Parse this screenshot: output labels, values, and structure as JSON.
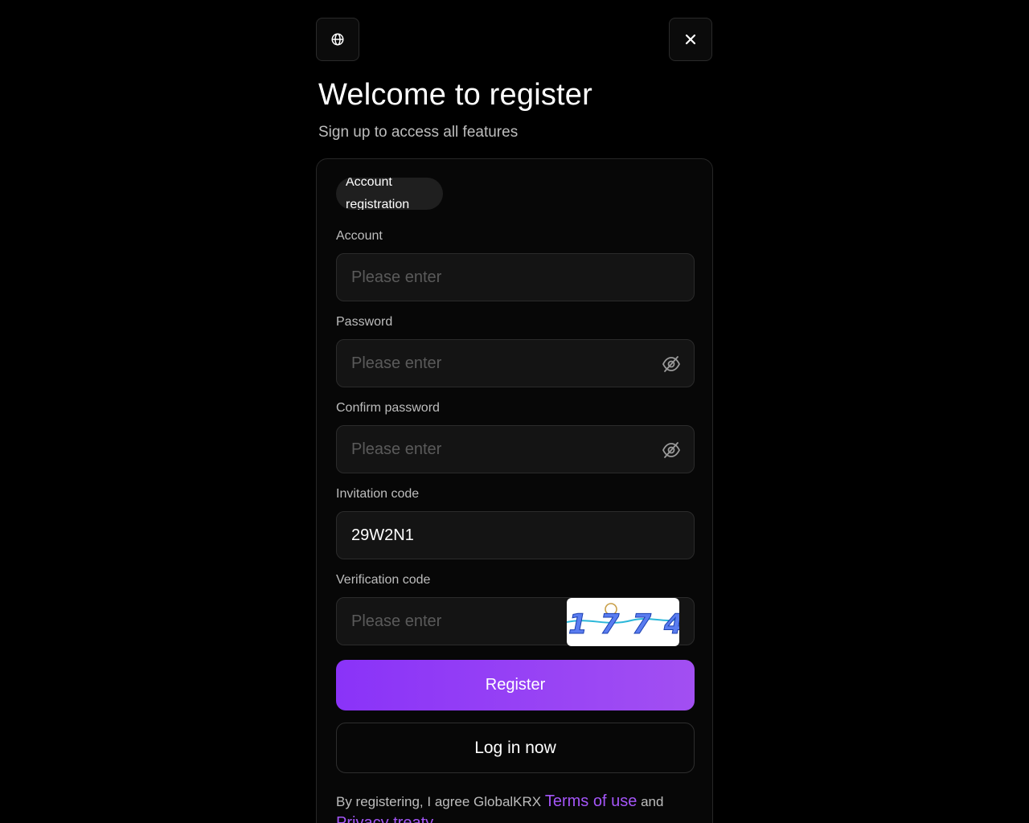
{
  "header": {
    "language_icon": "globe-icon",
    "close_icon": "close-icon",
    "title": "Welcome to register",
    "subtitle": "Sign up to access all features"
  },
  "tabs": [
    {
      "label": "Account registration",
      "active": true
    }
  ],
  "form": {
    "account": {
      "label": "Account",
      "placeholder": "Please enter",
      "value": ""
    },
    "password": {
      "label": "Password",
      "placeholder": "Please enter",
      "value": "",
      "toggle_icon": "eye-slash-icon"
    },
    "confirm_password": {
      "label": "Confirm password",
      "placeholder": "Please enter",
      "value": "",
      "toggle_icon": "eye-slash-icon"
    },
    "invitation_code": {
      "label": "Invitation code",
      "placeholder": "Please enter",
      "value": "29W2N1"
    },
    "verification_code": {
      "label": "Verification code",
      "placeholder": "Please enter",
      "value": "",
      "captcha_text": "1774"
    }
  },
  "buttons": {
    "register": "Register",
    "login": "Log in now"
  },
  "agreement": {
    "prefix": "By registering, I agree GlobalKRX",
    "terms_link": "Terms of use",
    "conjunction": "and",
    "privacy_link": "Privacy treaty"
  },
  "colors": {
    "background": "#000000",
    "accent_start": "#8a33f8",
    "accent_end": "#a24ff2",
    "link": "#a455f7"
  }
}
